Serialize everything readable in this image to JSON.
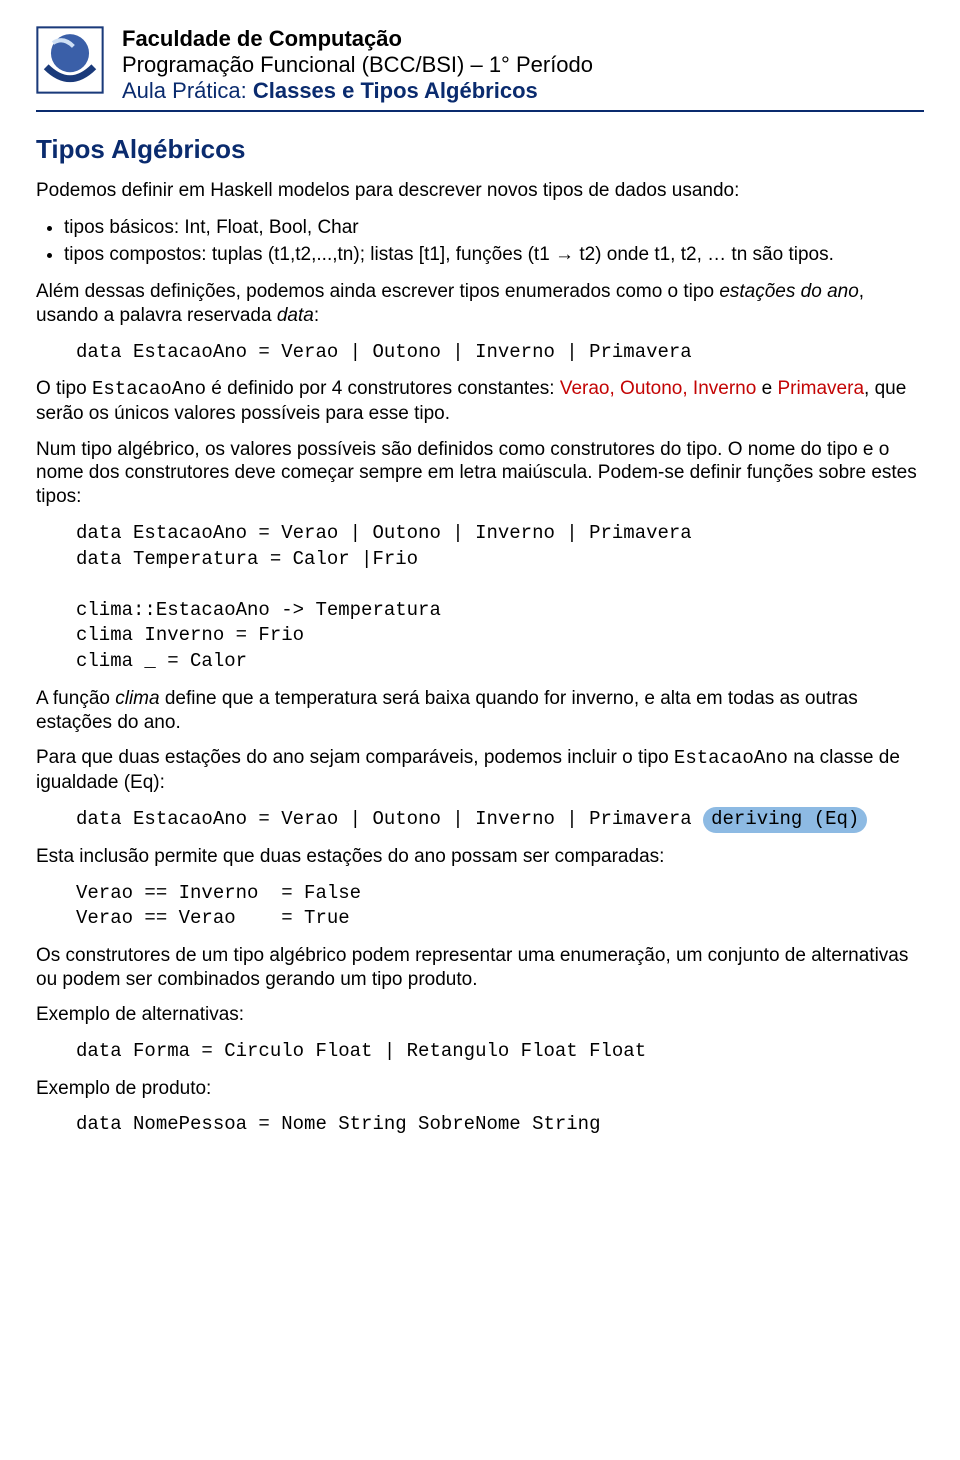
{
  "header": {
    "line1": "Faculdade de Computação",
    "line2": "Programação Funcional  (BCC/BSI) – 1° Período",
    "line3_prefix": "Aula Prática:",
    "line3_rest": " Classes e Tipos Algébricos"
  },
  "section_title": "Tipos Algébricos",
  "intro_para": "Podemos definir em Haskell modelos para descrever novos tipos de dados usando:",
  "bullets": [
    "tipos básicos: Int, Float, Bool, Char",
    "tipos compostos: tuplas (t1,t2,...,tn); listas [t1], funções (t1 → t2) onde t1, t2, … tn são tipos."
  ],
  "para_defs_1": "Além dessas definições, podemos ainda escrever tipos enumerados como o tipo ",
  "para_defs_ital": "estações do ano",
  "para_defs_2": ", usando a palavra reservada ",
  "para_defs_kw": "data",
  "para_defs_3": ":",
  "code1": "data EstacaoAno = Verao | Outono | Inverno | Primavera",
  "para_estacao_1": "O tipo ",
  "para_estacao_code": "EstacaoAno",
  "para_estacao_2": " é definido por 4 construtores constantes: ",
  "red_list": "Verao, Outono, Inverno",
  "para_estacao_e": " e ",
  "red_primavera": "Primavera",
  "para_estacao_3": ", que serão os únicos valores possíveis para esse tipo.",
  "para_note": "Num tipo algébrico, os valores possíveis são definidos como construtores do tipo. O nome do tipo e o nome dos construtores deve começar sempre em letra maiúscula. Podem-se definir funções sobre estes tipos:",
  "code2": "data EstacaoAno = Verao | Outono | Inverno | Primavera\ndata Temperatura = Calor |Frio\n\nclima::EstacaoAno -> Temperatura\nclima Inverno = Frio\nclima _ = Calor",
  "para_clima_1": "A função ",
  "para_clima_ital": "clima",
  "para_clima_2": " define que a temperatura será baixa quando for inverno, e alta em todas as outras estações do ano.",
  "para_eq_1": "Para que duas estações do ano sejam comparáveis, podemos incluir o tipo ",
  "para_eq_code": "EstacaoAno",
  "para_eq_2": " na classe de igualdade (Eq):",
  "code3_main": "data EstacaoAno = Verao | Outono | Inverno | Primavera ",
  "code3_hl": " deriving (Eq)",
  "para_incl": "Esta inclusão permite que duas estações do ano possam ser comparadas:",
  "code4": "Verao == Inverno  = False\nVerao == Verao    = True",
  "para_constr": "Os construtores de um tipo algébrico podem representar uma enumeração, um conjunto de alternativas ou podem ser combinados gerando um tipo produto.",
  "label_alt": "Exemplo de alternativas:",
  "code5": "data Forma = Circulo Float | Retangulo Float Float",
  "label_prod": "Exemplo de produto:",
  "code6": "data NomePessoa = Nome String SobreNome String"
}
